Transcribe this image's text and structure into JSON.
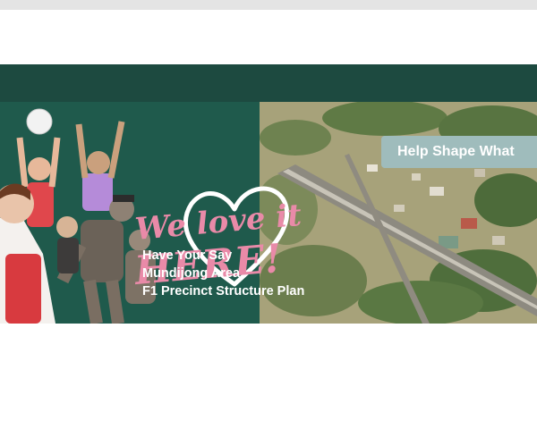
{
  "banner": {
    "headline": "We love it HERE!",
    "headline_line1": "We love it",
    "headline_line2": "HERE!",
    "subtitle_lines": [
      "Have Your Say",
      "Mundijong Area",
      "F1 Precinct Structure Plan"
    ],
    "cta_label": "Help Shape What"
  },
  "colors": {
    "banner_green": "#1f5a4c",
    "accent_pink": "#e98aa8",
    "cta_bg": "#9fbcbc"
  }
}
